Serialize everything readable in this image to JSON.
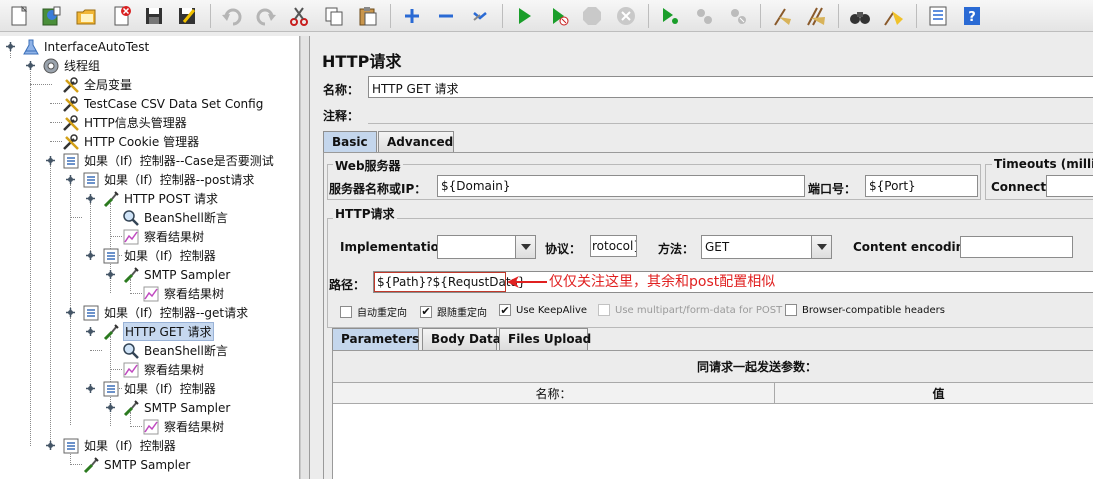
{
  "toolbar": {
    "icons": [
      "new-icon",
      "templates-icon",
      "open-icon",
      "close-icon",
      "save-icon",
      "save-as-icon",
      "undo-icon",
      "redo-icon",
      "cut-icon",
      "copy-icon",
      "paste-icon",
      "expand-icon",
      "collapse-icon",
      "toggle-icon",
      "start-icon",
      "start-no-pause-icon",
      "stop-icon",
      "shutdown-icon",
      "remote-start-icon",
      "remote-stop-icon",
      "remote-shutdown-icon",
      "clear-icon",
      "clear-all-icon",
      "search-icon",
      "reset-search-icon",
      "function-helper-icon",
      "help-icon"
    ]
  },
  "tree": {
    "nodes": [
      {
        "label": "InterfaceAutoTest",
        "icon": "test-plan-icon"
      },
      {
        "label": "线程组",
        "icon": "thread-group-icon"
      },
      {
        "label": "全局变量",
        "icon": "config-element-icon"
      },
      {
        "label": "TestCase CSV Data Set Config",
        "icon": "config-element-icon"
      },
      {
        "label": "HTTP信息头管理器",
        "icon": "config-element-icon"
      },
      {
        "label": "HTTP Cookie 管理器",
        "icon": "config-element-icon"
      },
      {
        "label": "如果（If）控制器--Case是否要测试",
        "icon": "controller-icon"
      },
      {
        "label": "如果（If）控制器--post请求",
        "icon": "controller-icon"
      },
      {
        "label": "HTTP POST 请求",
        "icon": "sampler-icon"
      },
      {
        "label": "BeanShell断言",
        "icon": "assertion-icon"
      },
      {
        "label": "察看结果树",
        "icon": "listener-icon"
      },
      {
        "label": "如果（If）控制器",
        "icon": "controller-icon"
      },
      {
        "label": "SMTP Sampler",
        "icon": "sampler-icon"
      },
      {
        "label": "察看结果树",
        "icon": "listener-icon"
      },
      {
        "label": "如果（If）控制器--get请求",
        "icon": "controller-icon"
      },
      {
        "label": "HTTP GET 请求",
        "icon": "sampler-icon"
      },
      {
        "label": "BeanShell断言",
        "icon": "assertion-icon"
      },
      {
        "label": "察看结果树",
        "icon": "listener-icon"
      },
      {
        "label": "如果（If）控制器",
        "icon": "controller-icon"
      },
      {
        "label": "SMTP Sampler",
        "icon": "sampler-icon"
      },
      {
        "label": "察看结果树",
        "icon": "listener-icon"
      },
      {
        "label": "如果（If）控制器",
        "icon": "controller-icon"
      },
      {
        "label": "SMTP Sampler",
        "icon": "sampler-icon"
      }
    ],
    "selected_index": 15
  },
  "panel": {
    "title": "HTTP请求",
    "name_label": "名称：",
    "name_value": "HTTP GET 请求",
    "comment_label": "注释：",
    "tabs": [
      "Basic",
      "Advanced"
    ],
    "web_server_title": "Web服务器",
    "server_label": "服务器名称或IP：",
    "server_value": "${Domain}",
    "port_label": "端口号：",
    "port_value": "${Port}",
    "timeouts_title": "Timeouts (millisec",
    "connect_label": "Connect:",
    "http_request_title": "HTTP请求",
    "impl_label": "Implementation:",
    "protocol_label": "协议：",
    "protocol_value": "rotocol}",
    "method_label": "方法：",
    "method_value": "GET",
    "encoding_label": "Content encoding:",
    "path_label": "路径：",
    "path_value": "${Path}?${RequstData}",
    "annotation": "仅仅关注这里，其余和post配置相似",
    "checkboxes": [
      {
        "label": "自动重定向",
        "checked": false,
        "enabled": true
      },
      {
        "label": "跟随重定向",
        "checked": true,
        "enabled": true
      },
      {
        "label": "Use KeepAlive",
        "checked": true,
        "enabled": true
      },
      {
        "label": "Use multipart/form-data for POST",
        "checked": false,
        "enabled": false
      },
      {
        "label": "Browser-compatible headers",
        "checked": false,
        "enabled": true
      }
    ],
    "check_mark": "✔",
    "sub_tabs": [
      "Parameters",
      "Body Data",
      "Files Upload"
    ],
    "params_title": "同请求一起发送参数：",
    "col_name": "名称：",
    "col_value": "值"
  },
  "colors": {
    "accent": "#e02020",
    "selection": "#c6d8ef"
  }
}
